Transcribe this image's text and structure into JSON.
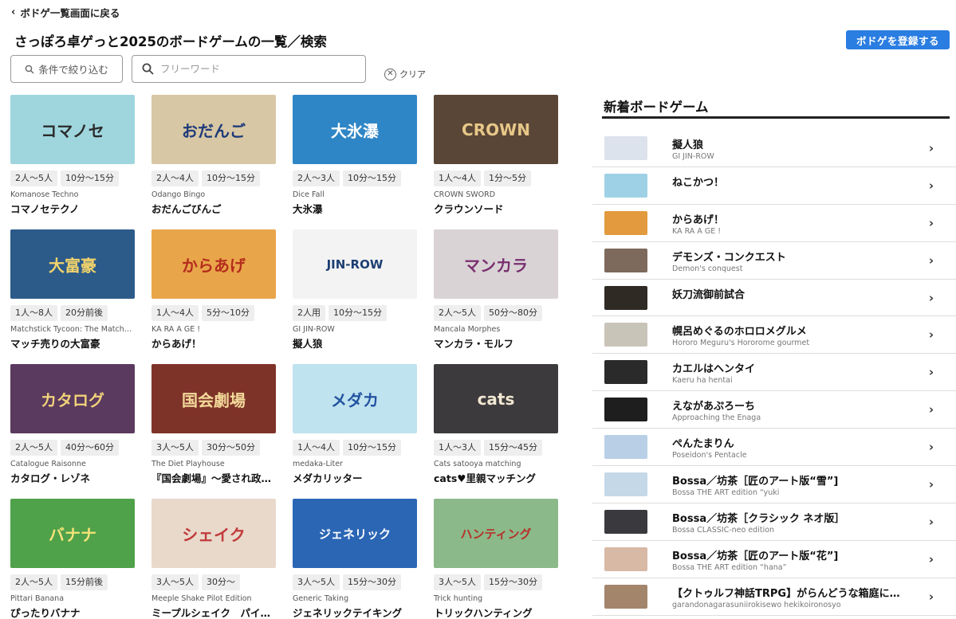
{
  "nav": {
    "back_label": "ボドゲ一覧画面に戻る"
  },
  "page": {
    "title": "さっぽろ卓ゲっと2025のボードゲームの一覧／検索"
  },
  "actions": {
    "register_label": "ボドゲを登録する"
  },
  "filters": {
    "filter_label": "条件で絞り込む",
    "search_placeholder": "フリーワード",
    "clear_label": "クリア"
  },
  "games": [
    {
      "players": "2人〜5人",
      "time": "10分〜15分",
      "sub": "Komanose Techno",
      "name": "コマノセテクノ",
      "bg": "#9fd6de",
      "fg": "#2b2b2b",
      "art": "コマノセ"
    },
    {
      "players": "2人〜4人",
      "time": "10分〜15分",
      "sub": "Odango Bingo",
      "name": "おだんごびんご",
      "bg": "#d8c7a4",
      "fg": "#1d3a7a",
      "art": "おだんご"
    },
    {
      "players": "2人〜3人",
      "time": "10分〜15分",
      "sub": "Dice Fall",
      "name": "大氷瀑",
      "bg": "#2f86c6",
      "fg": "#ffffff",
      "art": "大氷瀑"
    },
    {
      "players": "1人〜4人",
      "time": "1分〜5分",
      "sub": "CROWN SWORD",
      "name": "クラウンソード",
      "bg": "#5a4636",
      "fg": "#e7c889",
      "art": "CROWN"
    },
    {
      "players": "1人〜8人",
      "time": "20分前後",
      "sub": "Matchstick Tycoon: The Match…",
      "name": "マッチ売りの大富豪",
      "bg": "#2c5b8a",
      "fg": "#f2d36b",
      "art": "大富豪"
    },
    {
      "players": "1人〜4人",
      "time": "5分〜10分",
      "sub": "KA RA A GE !",
      "name": "からあげ！",
      "bg": "#e9a54a",
      "fg": "#b52d1d",
      "art": "からあげ"
    },
    {
      "players": "2人用",
      "time": "10分〜15分",
      "sub": "GI JIN-ROW",
      "name": "擬人狼",
      "bg": "#f3f3f3",
      "fg": "#1c3f73",
      "art": "JIN-ROW"
    },
    {
      "players": "2人〜5人",
      "time": "50分〜80分",
      "sub": "Mancala Morphes",
      "name": "マンカラ・モルフ",
      "bg": "#d9d3d6",
      "fg": "#7a2f6f",
      "art": "マンカラ"
    },
    {
      "players": "2人〜5人",
      "time": "40分〜60分",
      "sub": "Catalogue Raisonne",
      "name": "カタログ・レゾネ",
      "bg": "#5a3a5e",
      "fg": "#f1d27a",
      "art": "カタログ"
    },
    {
      "players": "3人〜5人",
      "time": "30分〜50分",
      "sub": "The Diet Playhouse",
      "name": "『国会劇場』〜愛され政…",
      "bg": "#7e3328",
      "fg": "#f3d99a",
      "art": "国会劇場"
    },
    {
      "players": "1人〜4人",
      "time": "10分〜15分",
      "sub": "medaka-Liter",
      "name": "メダカリッター",
      "bg": "#bfe3ef",
      "fg": "#2453a0",
      "art": "メダカ"
    },
    {
      "players": "1人〜3人",
      "time": "15分〜45分",
      "sub": "Cats satooya matching",
      "name": "cats♥里親マッチング",
      "bg": "#3c3a3d",
      "fg": "#f1e7d2",
      "art": "cats"
    },
    {
      "players": "2人〜5人",
      "time": "15分前後",
      "sub": "Pittari Banana",
      "name": "ぴったりバナナ",
      "bg": "#4fa14a",
      "fg": "#f4e37a",
      "art": "バナナ"
    },
    {
      "players": "3人〜5人",
      "time": "30分〜",
      "sub": "Meeple Shake Pilot Edition",
      "name": "ミープルシェイク　パイ…",
      "bg": "#e8d9cb",
      "fg": "#c23a3a",
      "art": "シェイク"
    },
    {
      "players": "3人〜5人",
      "time": "15分〜30分",
      "sub": "Generic Taking",
      "name": "ジェネリックテイキング",
      "bg": "#2b66b5",
      "fg": "#ffffff",
      "art": "ジェネリック"
    },
    {
      "players": "3人〜5人",
      "time": "15分〜30分",
      "sub": "Trick hunting",
      "name": "トリックハンティング",
      "bg": "#8bb98a",
      "fg": "#b6322a",
      "art": "ハンティング"
    }
  ],
  "new_games": {
    "title": "新着ボードゲーム",
    "items": [
      {
        "name": "擬人狼",
        "sub": "GI JIN-ROW",
        "bg": "#dde3ec"
      },
      {
        "name": "ねこかつ！",
        "sub": "",
        "bg": "#9fd1e6"
      },
      {
        "name": "からあげ！",
        "sub": "KA RA A GE !",
        "bg": "#e39a3e"
      },
      {
        "name": "デモンズ・コンクエスト",
        "sub": "Demon's conquest",
        "bg": "#7d6a5c"
      },
      {
        "name": "妖刀流御前試合",
        "sub": "",
        "bg": "#2f2a24"
      },
      {
        "name": "幌呂めぐるのホロロメグルメ",
        "sub": "Hororo Meguru's Hororome gourmet",
        "bg": "#c9c4b8"
      },
      {
        "name": "カエルはヘンタイ",
        "sub": "Kaeru ha hentai",
        "bg": "#2a2a2a"
      },
      {
        "name": "えながあぷろーち",
        "sub": "Approaching the Enaga",
        "bg": "#1e1e1e"
      },
      {
        "name": "ぺんたまりん",
        "sub": "Poseidon's Pentacle",
        "bg": "#b9cfe6"
      },
      {
        "name": "Bossa／坊茶［匠のアート版“雪”]",
        "sub": "Bossa THE ART edition “yuki",
        "bg": "#c5d8e8"
      },
      {
        "name": "Bossa／坊茶［クラシック ネオ版］",
        "sub": "Bossa CLASSIC-neo edition",
        "bg": "#3a3a3e"
      },
      {
        "name": "Bossa／坊茶［匠のアート版“花”]",
        "sub": "Bossa THE ART edition “hana”",
        "bg": "#d7b9a5"
      },
      {
        "name": "【クトゥルフ神話TRPG】がらんどうな箱庭に…",
        "sub": "garandonagarasuniirokisewo hekikoironosyo",
        "bg": "#a3856b"
      }
    ]
  }
}
